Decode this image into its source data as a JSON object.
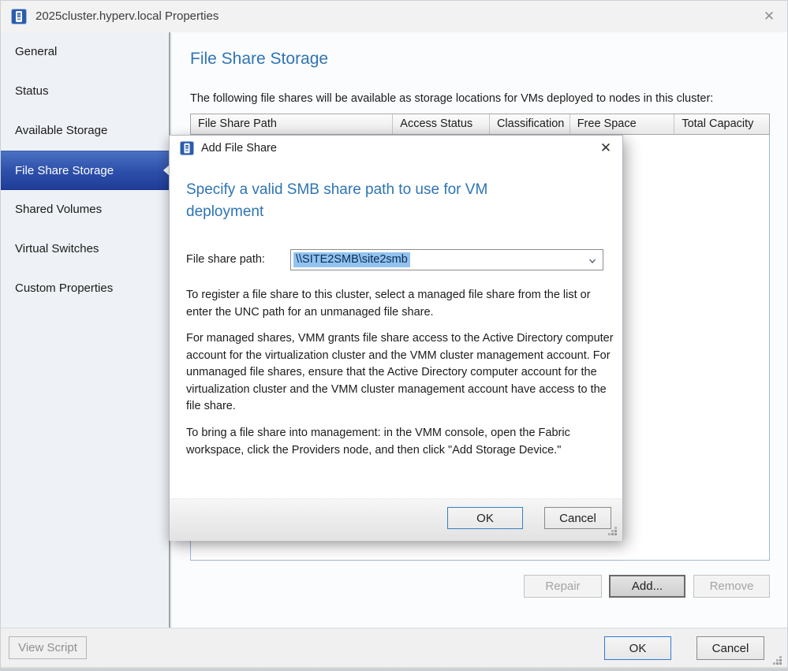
{
  "window": {
    "title": "2025cluster.hyperv.local Properties",
    "close_glyph": "✕"
  },
  "sidebar": {
    "items": [
      {
        "label": "General",
        "selected": false
      },
      {
        "label": "Status",
        "selected": false
      },
      {
        "label": "Available Storage",
        "selected": false
      },
      {
        "label": "File Share Storage",
        "selected": true
      },
      {
        "label": "Shared Volumes",
        "selected": false
      },
      {
        "label": "Virtual Switches",
        "selected": false
      },
      {
        "label": "Custom Properties",
        "selected": false
      }
    ]
  },
  "main": {
    "heading": "File Share Storage",
    "description": "The following file shares will be available as storage locations for VMs deployed to nodes in this cluster:",
    "table": {
      "columns": [
        "File Share Path",
        "Access Status",
        "Classification",
        "Free Space",
        "Total Capacity"
      ],
      "rows": []
    },
    "actions": {
      "repair": "Repair",
      "add": "Add...",
      "remove": "Remove"
    }
  },
  "dialog": {
    "title": "Add File Share",
    "close_glyph": "✕",
    "heading": "Specify a valid SMB share path to use for VM deployment",
    "field_label": "File share path:",
    "field_value": "\\\\SITE2SMB\\site2smb",
    "paragraphs": [
      "To register a file share to this cluster, select a managed file share from the list or enter the UNC path for an unmanaged file share.",
      "For managed shares, VMM grants file share access to the Active Directory computer account for the virtualization cluster and the VMM cluster management account. For unmanaged file shares, ensure that the Active Directory computer account for the virtualization cluster and the VMM cluster management account have access to the file share.",
      "To bring a file share into management: in the VMM console, open the Fabric workspace, click the Providers node, and then click \"Add Storage Device.\""
    ],
    "ok": "OK",
    "cancel": "Cancel"
  },
  "footer": {
    "view_script": "View Script",
    "ok": "OK",
    "cancel": "Cancel"
  },
  "colors": {
    "heading_blue": "#2e74b5",
    "nav_selected_top": "#4a71c2",
    "nav_selected_bottom": "#203e98",
    "selection_highlight": "#92c3ef",
    "selection_text": "#0b2a55",
    "default_button_border": "#2f7cd6",
    "table_body_border": "#9fb9d0",
    "icon_blue": "#2b5cab"
  }
}
